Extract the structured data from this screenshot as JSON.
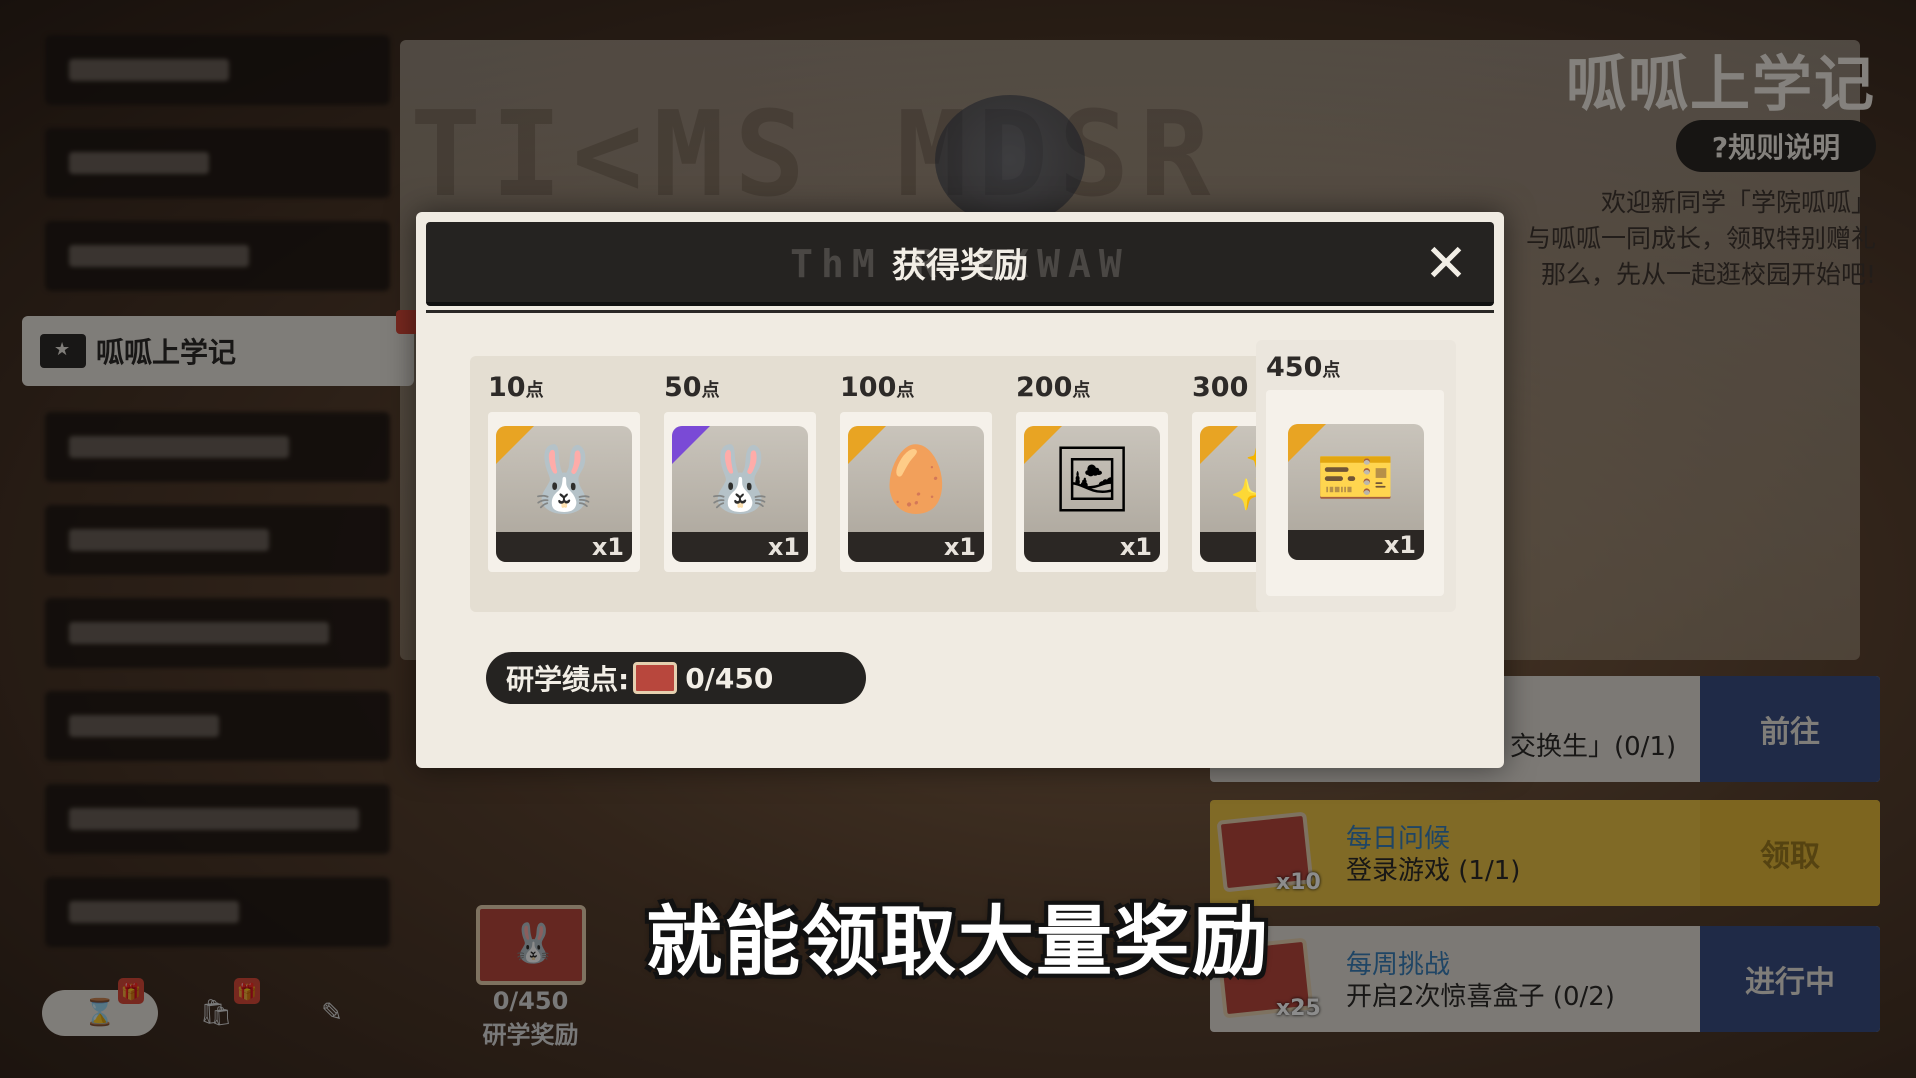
{
  "page": {
    "title": "呱呱上学记",
    "rules_label": "?规则说明",
    "welcome_lines": [
      "欢迎新同学「学院呱呱」",
      "与呱呱一同成长，领取特别赠礼",
      "那么，先从一起逛校园开始吧!"
    ]
  },
  "sidebar": {
    "active_label": "呱呱上学记"
  },
  "bottom": {
    "tab_icons": [
      "hourglass-icon",
      "gift-bag-icon",
      "pencil-icon"
    ],
    "research_count": "0/450",
    "research_label": "研学奖励"
  },
  "tasks": [
    {
      "title": "",
      "desc": "交换生」(0/1)",
      "action": "前往",
      "count": ""
    },
    {
      "title": "每日问候",
      "desc": "登录游戏 (1/1)",
      "action": "领取",
      "count": "x10"
    },
    {
      "title": "每周挑战",
      "desc": "开启2次惊喜盒子 (0/2)",
      "action": "进行中",
      "count": "x25"
    }
  ],
  "modal": {
    "title": "获得奖励",
    "rewards": [
      {
        "points": "10",
        "unit": "点",
        "qty": "x1",
        "art": "🐰",
        "rarity": "orange"
      },
      {
        "points": "50",
        "unit": "点",
        "qty": "x1",
        "art": "🐰",
        "rarity": "purple"
      },
      {
        "points": "100",
        "unit": "点",
        "qty": "x1",
        "art": "🥚",
        "rarity": "orange"
      },
      {
        "points": "200",
        "unit": "点",
        "qty": "x1",
        "art": "🖼",
        "rarity": "orange"
      },
      {
        "points": "300",
        "unit": "",
        "qty": "",
        "art": "✨",
        "rarity": "orange"
      },
      {
        "points": "450",
        "unit": "点",
        "qty": "x1",
        "art": "🎫",
        "rarity": "orange"
      }
    ],
    "points_label": "研学绩点:",
    "points_value": "0/450"
  },
  "subtitle": "就能领取大量奖励",
  "colors": {
    "accent_blue": "#3a4e82",
    "accent_yellow": "#e9c146",
    "rarity_orange": "#e8a423",
    "rarity_purple": "#7a4ad6",
    "modal_dark": "#252321"
  }
}
